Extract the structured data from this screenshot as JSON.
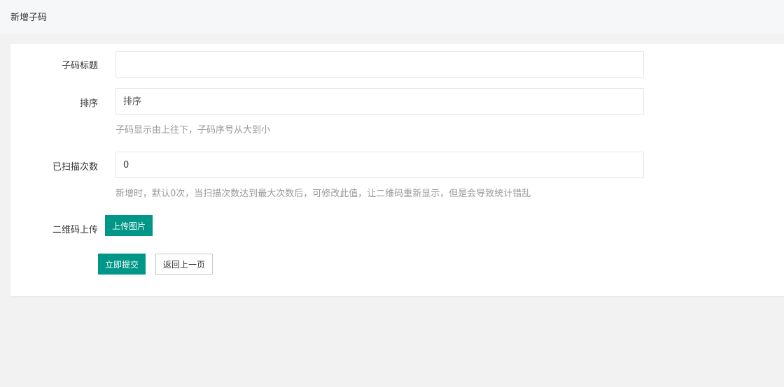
{
  "header": {
    "title": "新增子码"
  },
  "form": {
    "subcode_title": {
      "label": "子码标题",
      "value": "",
      "placeholder": ""
    },
    "sort": {
      "label": "排序",
      "value": "",
      "placeholder": "排序",
      "hint": "子码显示由上往下，子码序号从大到小"
    },
    "scan_count": {
      "label": "已扫描次数",
      "value": "0",
      "hint": "新增时，默认0次，当扫描次数达到最大次数后，可修改此值，让二维码重新显示，但是会导致统计错乱"
    },
    "qr_upload": {
      "label": "二维码上传",
      "button_label": "上传图片"
    }
  },
  "actions": {
    "submit_label": "立即提交",
    "back_label": "返回上一页"
  },
  "colors": {
    "primary": "#009688",
    "hint": "#999999",
    "border": "#e6e6e6"
  }
}
